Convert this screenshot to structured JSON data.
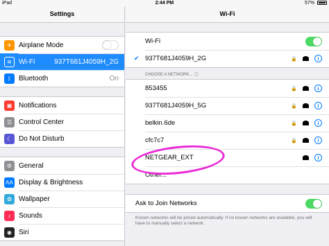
{
  "status_bar": {
    "device": "iPad",
    "time": "2:44 PM",
    "battery": "57%"
  },
  "left_panel": {
    "title": "Settings",
    "groups": [
      [
        {
          "label": "Airplane Mode",
          "icon": "airplane-icon",
          "color": "#ff9500",
          "control": "toggle-off"
        },
        {
          "label": "Wi-Fi",
          "icon": "wifi-icon",
          "color": "#1e8bff",
          "value": "937T681J4059H_2G",
          "selected": true
        },
        {
          "label": "Bluetooth",
          "icon": "bluetooth-icon",
          "color": "#007aff",
          "value": "On"
        }
      ],
      [
        {
          "label": "Notifications",
          "icon": "notifications-icon",
          "color": "#ff3b30"
        },
        {
          "label": "Control Center",
          "icon": "control-center-icon",
          "color": "#8e8e93"
        },
        {
          "label": "Do Not Disturb",
          "icon": "moon-icon",
          "color": "#5856d6"
        }
      ],
      [
        {
          "label": "General",
          "icon": "gear-icon",
          "color": "#8e8e93"
        },
        {
          "label": "Display & Brightness",
          "icon": "brightness-icon",
          "color": "#007aff"
        },
        {
          "label": "Wallpaper",
          "icon": "wallpaper-icon",
          "color": "#34aadc"
        },
        {
          "label": "Sounds",
          "icon": "speaker-icon",
          "color": "#ff2d55"
        },
        {
          "label": "Siri",
          "icon": "siri-icon",
          "color": "#222222"
        }
      ]
    ]
  },
  "right_panel": {
    "title": "Wi-Fi",
    "wifi_toggle_label": "Wi-Fi",
    "wifi_enabled": true,
    "connected_network": "937T681J4059H_2G",
    "choose_header": "CHOOSE A NETWORK...",
    "networks": [
      {
        "name": "853455",
        "locked": true
      },
      {
        "name": "937T681J4059H_5G",
        "locked": true
      },
      {
        "name": "belkin.6de",
        "locked": true
      },
      {
        "name": "cfc7c7",
        "locked": true
      },
      {
        "name": "NETGEAR_EXT",
        "locked": false,
        "highlighted": true
      }
    ],
    "other_label": "Other...",
    "ask_join_label": "Ask to Join Networks",
    "ask_join_enabled": true,
    "footer": "Known networks will be joined automatically. If no known networks are available, you will have to manually select a network."
  },
  "colors": {
    "accent": "#007aff",
    "selected_row": "#1e8bff",
    "toggle_on": "#4cd964",
    "annotation": "#ea2ad6"
  }
}
